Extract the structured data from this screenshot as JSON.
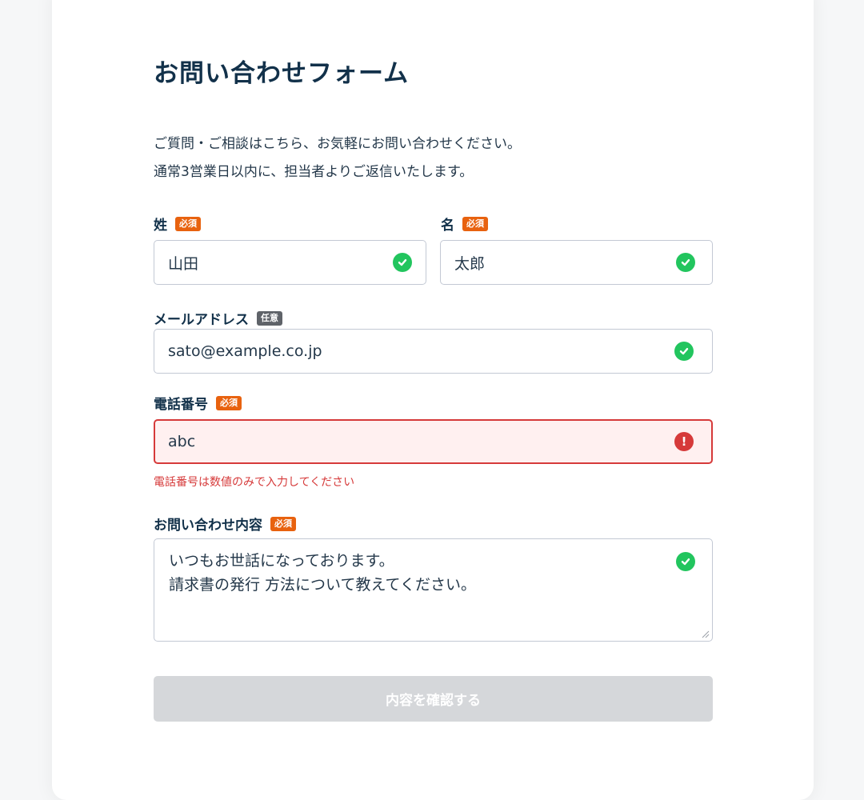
{
  "form": {
    "title": "お問い合わせフォーム",
    "lead_line1": "ご質問・ご相談はこちら、お気軽にお問い合わせください。",
    "lead_line2": "通常3営業日以内に、担当者よりご返信いたします。"
  },
  "badges": {
    "required": "必須",
    "optional": "任意"
  },
  "fields": {
    "last_name": {
      "label": "姓",
      "value": "山田",
      "status": "valid"
    },
    "first_name": {
      "label": "名",
      "value": "太郎",
      "status": "valid"
    },
    "email": {
      "label": "メールアドレス",
      "value": "sato@example.co.jp",
      "status": "valid"
    },
    "phone": {
      "label": "電話番号",
      "value": "abc",
      "status": "error",
      "error_message": "電話番号は数値のみで入力してください",
      "error_icon": "!"
    },
    "message": {
      "label": "お問い合わせ内容",
      "line1": "いつもお世話になっております。",
      "line2": "請求書の発行 方法について教えてください。",
      "status": "valid"
    }
  },
  "submit": {
    "label": "内容を確認する",
    "disabled": true
  },
  "colors": {
    "required_badge": "#e8620f",
    "optional_badge": "#5f6369",
    "valid": "#22c55e",
    "error": "#d63a3a",
    "submit_disabled": "#d5d7da"
  },
  "icons": {
    "valid": "check-circle-icon",
    "error": "exclamation-circle-icon"
  }
}
